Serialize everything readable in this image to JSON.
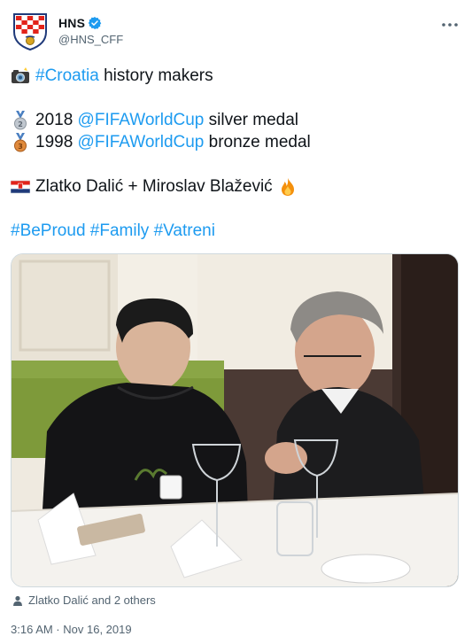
{
  "author": {
    "display_name": "HNS",
    "handle": "@HNS_CFF",
    "verified": true,
    "avatar_icon": "croatia-federation-crest-icon"
  },
  "tweet": {
    "line1": {
      "hashtag": "#Croatia",
      "text": " history makers"
    },
    "line2": {
      "year": "2018 ",
      "mention": "@FIFAWorldCup",
      "text": " silver medal"
    },
    "line3": {
      "year": "1998 ",
      "mention": "@FIFAWorldCup",
      "text": " bronze medal"
    },
    "line4": {
      "text": "Zlatko Dalić + Miroslav Blažević"
    },
    "hashtags": [
      "#BeProud",
      "#Family",
      "#Vatreni"
    ]
  },
  "media": {
    "tagged_text": "Zlatko Dalić and 2 others"
  },
  "meta": {
    "timestamp": "3:16 AM · Nov 16, 2019"
  },
  "colors": {
    "link": "#1d9bf0",
    "secondary_text": "#536471",
    "verified_badge": "#1d9bf0"
  }
}
